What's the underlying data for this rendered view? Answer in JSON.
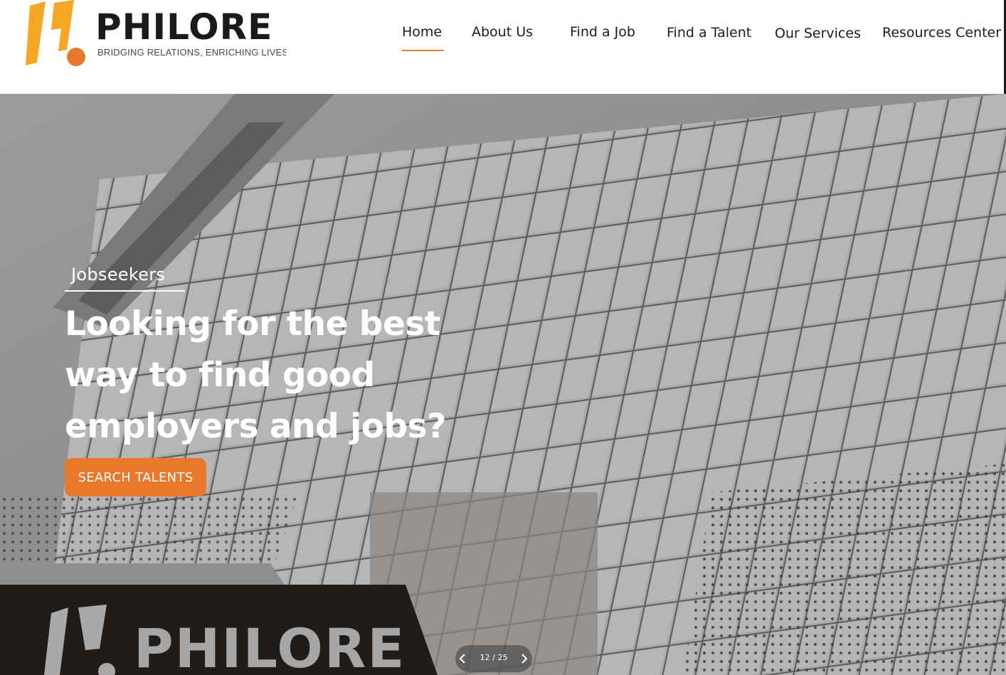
{
  "brand": {
    "name": "PHILORE",
    "tagline": "BRIDGING RELATIONS, ENRICHING LIVES",
    "accent": "#e8792c",
    "yellow": "#f5a623"
  },
  "nav": {
    "items": [
      {
        "label": "Home",
        "active": true
      },
      {
        "label": "About Us"
      },
      {
        "label": "Find a Job"
      },
      {
        "label": "Find a Talent"
      },
      {
        "label": "Our Services"
      },
      {
        "label": "Resources Center"
      }
    ]
  },
  "hero": {
    "tag": "Jobseekers",
    "title": "Looking for the best way to find good employers and jobs?",
    "cta": "SEARCH TALENTS",
    "sign_text": "PHILORE"
  },
  "slider": {
    "counter": "12 / 25",
    "prev_icon": "chevron-left-icon",
    "next_icon": "chevron-right-icon"
  }
}
